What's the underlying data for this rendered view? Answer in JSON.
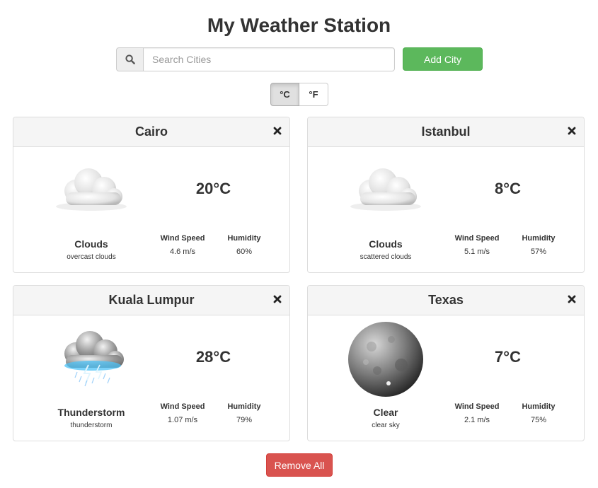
{
  "app": {
    "title": "My Weather Station"
  },
  "search": {
    "placeholder": "Search Cities",
    "value": "",
    "icon": "search-icon"
  },
  "add_button": {
    "label": "Add City"
  },
  "units": {
    "celsius_label": "°C",
    "fahrenheit_label": "°F",
    "selected": "°C"
  },
  "cities": [
    {
      "name": "Cairo",
      "temp": "20°C",
      "condition": "Clouds",
      "description": "overcast clouds",
      "wind_label": "Wind Speed",
      "wind": "4.6 m/s",
      "humidity_label": "Humidity",
      "humidity": "60%",
      "icon": "cloud-icon"
    },
    {
      "name": "Istanbul",
      "temp": "8°C",
      "condition": "Clouds",
      "description": "scattered clouds",
      "wind_label": "Wind Speed",
      "wind": "5.1 m/s",
      "humidity_label": "Humidity",
      "humidity": "57%",
      "icon": "cloud-icon"
    },
    {
      "name": "Kuala Lumpur",
      "temp": "28°C",
      "condition": "Thunderstorm",
      "description": "thunderstorm",
      "wind_label": "Wind Speed",
      "wind": "1.07 m/s",
      "humidity_label": "Humidity",
      "humidity": "79%",
      "icon": "thunderstorm-icon"
    },
    {
      "name": "Texas",
      "temp": "7°C",
      "condition": "Clear",
      "description": "clear sky",
      "wind_label": "Wind Speed",
      "wind": "2.1 m/s",
      "humidity_label": "Humidity",
      "humidity": "75%",
      "icon": "moon-icon"
    }
  ],
  "remove_all_button": {
    "label": "Remove All"
  },
  "colors": {
    "success": "#5cb85c",
    "danger": "#d9534f",
    "panel_header": "#f5f5f5",
    "lightning": "#4fc3f7"
  }
}
